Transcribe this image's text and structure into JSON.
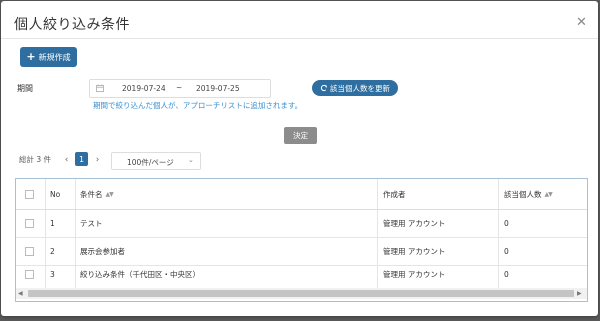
{
  "dialog": {
    "title": "個人絞り込み条件",
    "close_icon": "close-icon"
  },
  "toolbar": {
    "new_label": "新規作成",
    "new_icon": "plus-icon"
  },
  "period": {
    "label": "期間",
    "start": "2019-07-24",
    "separator": "~",
    "end": "2019-07-25",
    "calendar_icon": "calendar-icon",
    "update_label": "該当個人数を更新",
    "update_icon": "refresh-icon",
    "note": "期間で絞り込んだ個人が、アプローチリストに追加されます。"
  },
  "decide_label": "決定",
  "pagination": {
    "total": "総計 3 件",
    "prev": "‹",
    "current": "1",
    "next": "›",
    "per_page": "100件/ページ"
  },
  "table": {
    "headers": {
      "no": "No",
      "name": "条件名",
      "creator": "作成者",
      "count": "該当個人数"
    },
    "rows": [
      {
        "no": "1",
        "name": "テスト",
        "creator": "管理用 アカウント",
        "count": "0"
      },
      {
        "no": "2",
        "name": "展示会参加者",
        "creator": "管理用 アカウント",
        "count": "0"
      },
      {
        "no": "3",
        "name": "絞り込み条件（千代田区・中央区）",
        "creator": "管理用 アカウント",
        "count": "0"
      }
    ]
  },
  "colors": {
    "primary": "#2f6ea0",
    "link": "#3a8fd0",
    "decide": "#8c8c8c"
  }
}
